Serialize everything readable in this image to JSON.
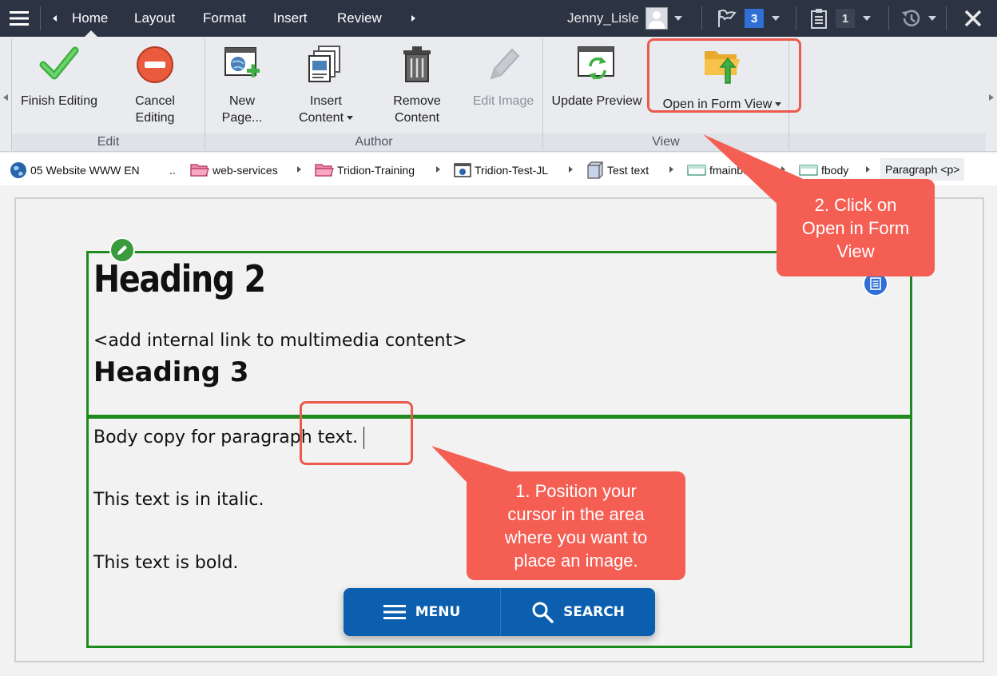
{
  "topbar": {
    "tabs": [
      "Home",
      "Layout",
      "Format",
      "Insert",
      "Review"
    ],
    "user_name": "Jenny_Lisle",
    "flag_count": "3",
    "clipboard_count": "1"
  },
  "ribbon": {
    "finish_editing": "Finish Editing",
    "cancel_editing_1": "Cancel",
    "cancel_editing_2": "Editing",
    "new_page_1": "New",
    "new_page_2": "Page...",
    "insert_content_1": "Insert",
    "insert_content_2": "Content",
    "remove_content_1": "Remove",
    "remove_content_2": "Content",
    "edit_image": "Edit Image",
    "update_preview": "Update Preview",
    "open_form_view": "Open in Form View",
    "groups": [
      "Edit",
      "Author",
      "View"
    ]
  },
  "breadcrumb": {
    "items": [
      "05 Website WWW EN",
      "..",
      "web-services",
      "Tridion-Training",
      "Tridion-Test-JL",
      "Test text",
      "fmainbo",
      "fbody",
      "Paragraph <p>"
    ]
  },
  "content": {
    "heading2": "Heading 2",
    "link_placeholder": "<add internal link to multimedia content>",
    "heading3": "Heading 3",
    "body_copy": "Body copy for paragraph text.",
    "italic_text": "This text is in italic.",
    "bold_text": "This text is bold."
  },
  "menubar": {
    "menu_label": "MENU",
    "search_label": "SEARCH"
  },
  "callouts": {
    "step1": [
      "1. Position your",
      "cursor in the area",
      "where you want to",
      "place an image."
    ],
    "step2": [
      "2. Click on",
      "Open in Form",
      "View"
    ]
  },
  "colors": {
    "topbar": "#2c3444",
    "accent_blue": "#2f6fd6",
    "callout_red": "#f45e53",
    "region_green": "#1d8a1d",
    "menubar_blue": "#0b5fae"
  }
}
